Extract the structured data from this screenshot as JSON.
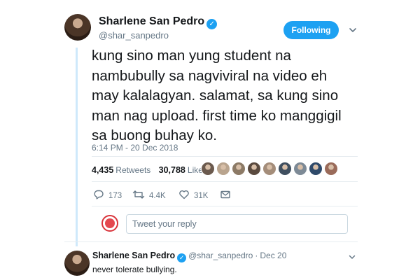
{
  "tweet": {
    "display_name": "Sharlene San Pedro",
    "handle": "@shar_sanpedro",
    "follow_label": "Following",
    "text_lines": [
      "kung sino man yung student na",
      "nambubully sa nagviviral na video eh",
      "may kalalagyan. salamat, sa kung sino",
      "man nag upload. first time ko manggigil",
      "sa buong buhay ko."
    ],
    "timestamp": "6:14 PM - 20 Dec 2018",
    "retweets_count": "4,435",
    "retweets_label": "Retweets",
    "likes_count": "30,788",
    "likes_label": "Likes",
    "liker_avatar_colors": [
      "#6b5a4e",
      "#b9a48e",
      "#8c7a66",
      "#5a4a3f",
      "#a48d7a",
      "#3f4f5f",
      "#7d8a96",
      "#2f4a6a",
      "#9a6b5a"
    ],
    "actions": {
      "reply_count": "173",
      "retweet_count": "4.4K",
      "like_count": "31K"
    }
  },
  "reply_box": {
    "placeholder": "Tweet your reply"
  },
  "reply_tweet": {
    "display_name": "Sharlene San Pedro",
    "handle": "@shar_sanpedro",
    "date": "Dec 20",
    "text": "never tolerate bullying."
  },
  "colors": {
    "accent": "#1da1f2",
    "thread_line": "#cfe9fb",
    "muted_text": "#657786"
  },
  "icons": [
    "verified-badge-icon",
    "chevron-down-icon",
    "reply-icon",
    "retweet-icon",
    "like-icon",
    "direct-message-icon"
  ]
}
